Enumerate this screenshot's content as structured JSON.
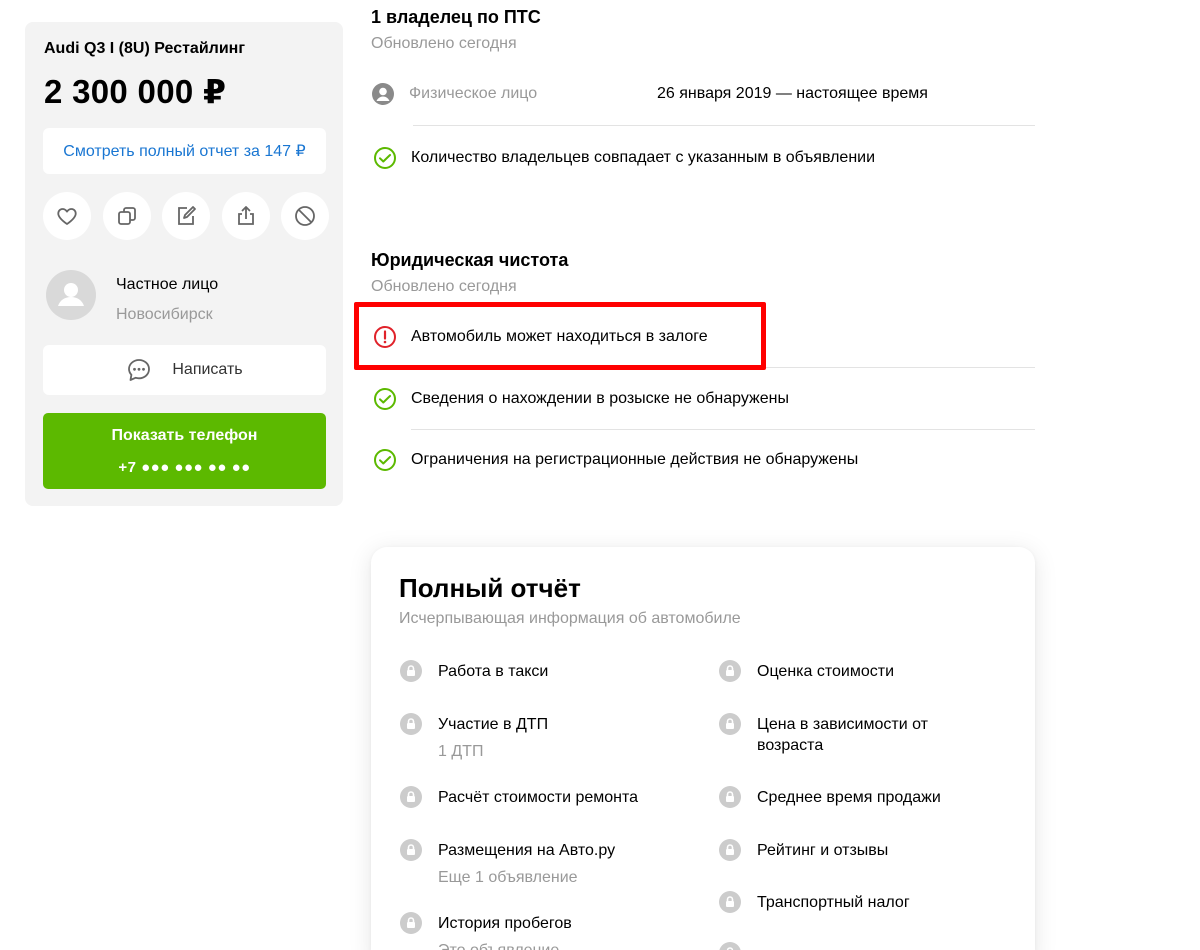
{
  "listing": {
    "title": "Audi Q3 I (8U) Рестайлинг",
    "price": "2 300 000 ₽",
    "report_button": "Смотреть полный отчет за 147 ₽",
    "actions": [
      "heart-icon",
      "copy-icon",
      "edit-icon",
      "share-icon",
      "block-icon"
    ]
  },
  "seller": {
    "type": "Частное лицо",
    "city": "Новосибирск",
    "write_label": "Написать",
    "phone_label": "Показать телефон",
    "phone_masked": "+7 ●●● ●●● ●● ●●"
  },
  "owners": {
    "title": "1 владелец по ПТС",
    "updated": "Обновлено сегодня",
    "owner_type": "Физическое лицо",
    "period": "26 января 2019 — настоящее время",
    "check": "Количество владельцев совпадает с указанным в объявлении"
  },
  "legal": {
    "title": "Юридическая чистота",
    "updated": "Обновлено сегодня",
    "items": [
      {
        "status": "warning",
        "text": "Автомобиль может находиться в залоге"
      },
      {
        "status": "ok",
        "text": "Сведения о нахождении в розыске не обнаружены"
      },
      {
        "status": "ok",
        "text": "Ограничения на регистрационные действия не обнаружены"
      }
    ]
  },
  "full_report": {
    "title": "Полный отчёт",
    "subtitle": "Исчерпывающая информация об автомобиле",
    "left": [
      {
        "label": "Работа в такси",
        "sub": ""
      },
      {
        "label": "Участие в ДТП",
        "sub": "1 ДТП"
      },
      {
        "label": "Расчёт стоимости ремонта",
        "sub": ""
      },
      {
        "label": "Размещения на Авто.ру",
        "sub": "Еще 1 объявление"
      },
      {
        "label": "История пробегов",
        "sub": "Это объявление"
      }
    ],
    "right": [
      {
        "label": "Оценка стоимости",
        "sub": ""
      },
      {
        "label": "Цена в зависимости от возраста",
        "sub": ""
      },
      {
        "label": "Среднее время продажи",
        "sub": ""
      },
      {
        "label": "Рейтинг и отзывы",
        "sub": ""
      },
      {
        "label": "Транспортный налог",
        "sub": ""
      }
    ]
  },
  "colors": {
    "ok": "#5cb900",
    "warning": "#e0222a",
    "link": "#1976d2",
    "highlight": "#ff0000"
  }
}
